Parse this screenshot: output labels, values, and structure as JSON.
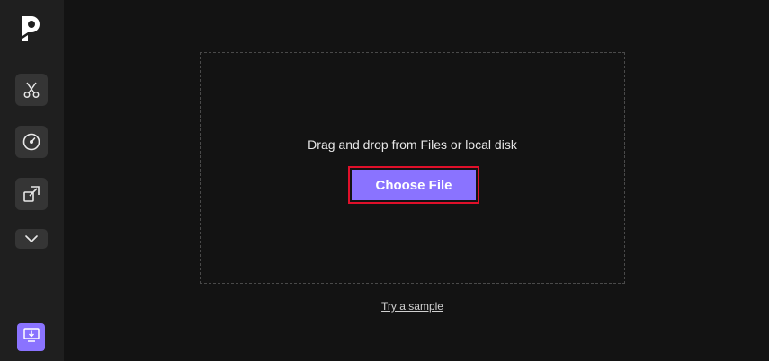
{
  "sidebar": {
    "logo_icon": "logo-p-icon",
    "tools": [
      {
        "name": "cut",
        "icon": "scissors-icon"
      },
      {
        "name": "speed",
        "icon": "speedometer-icon"
      },
      {
        "name": "resize",
        "icon": "resize-icon"
      }
    ],
    "more_icon": "chevron-down-icon",
    "download_icon": "download-icon"
  },
  "upload": {
    "drop_text": "Drag and drop from Files or local disk",
    "choose_file_label": "Choose File",
    "try_sample_label": "Try a sample"
  },
  "colors": {
    "accent": "#8a73ff",
    "highlight_border": "#e0102a",
    "background": "#131313",
    "sidebar": "#1f1f1f"
  }
}
